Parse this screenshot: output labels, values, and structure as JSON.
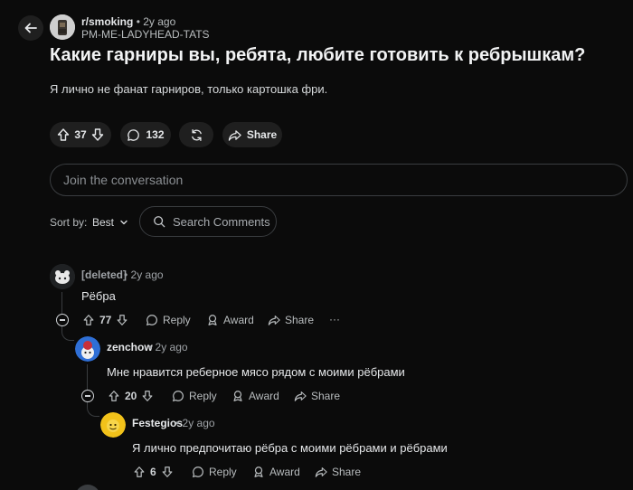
{
  "post": {
    "subreddit": "r/smoking",
    "age": "2y ago",
    "author": "PM-ME-LADYHEAD-TATS",
    "title": "Какие гарниры вы, ребята, любите готовить к ребрышкам?",
    "body": "Я лично не фанат гарниров, только картошка фри.",
    "votes": "37",
    "comments": "132",
    "share_label": "Share"
  },
  "composer": {
    "placeholder": "Join the conversation"
  },
  "sort": {
    "label": "Sort by:",
    "value": "Best",
    "search_placeholder": "Search Comments"
  },
  "comments": [
    {
      "author": "[deleted]",
      "age": "2y ago",
      "text": "Рёбра",
      "votes": "77",
      "reply": "Reply",
      "award": "Award",
      "share": "Share",
      "more": "···"
    },
    {
      "author": "zenchow",
      "age": "2y ago",
      "text": "Мне нравится реберное мясо рядом с моими рёбрами",
      "votes": "20",
      "reply": "Reply",
      "award": "Award",
      "share": "Share"
    },
    {
      "author": "Festegios",
      "age": "2y ago",
      "text": "Я лично предпочитаю рёбра с моими рёбрами и рёбрами",
      "votes": "6",
      "reply": "Reply",
      "award": "Award",
      "share": "Share"
    }
  ],
  "separator": "•",
  "icons": {
    "back": "arrow-left-icon",
    "upvote": "arrow-up-icon",
    "downvote": "arrow-down-icon",
    "comment": "speech-bubble-icon",
    "award": "refresh-icon",
    "share": "share-arrow-icon",
    "search": "magnifier-icon",
    "chevron": "chevron-down-icon",
    "collapse": "minus-circle-icon"
  },
  "colors": {
    "background": "#0b0b0b",
    "pill": "#1f1f1f",
    "border": "#3a3d40",
    "text": "#d7dadc",
    "festegios_avatar": "#f2c21a",
    "zenchow_avatar": "#2f6fd6"
  }
}
